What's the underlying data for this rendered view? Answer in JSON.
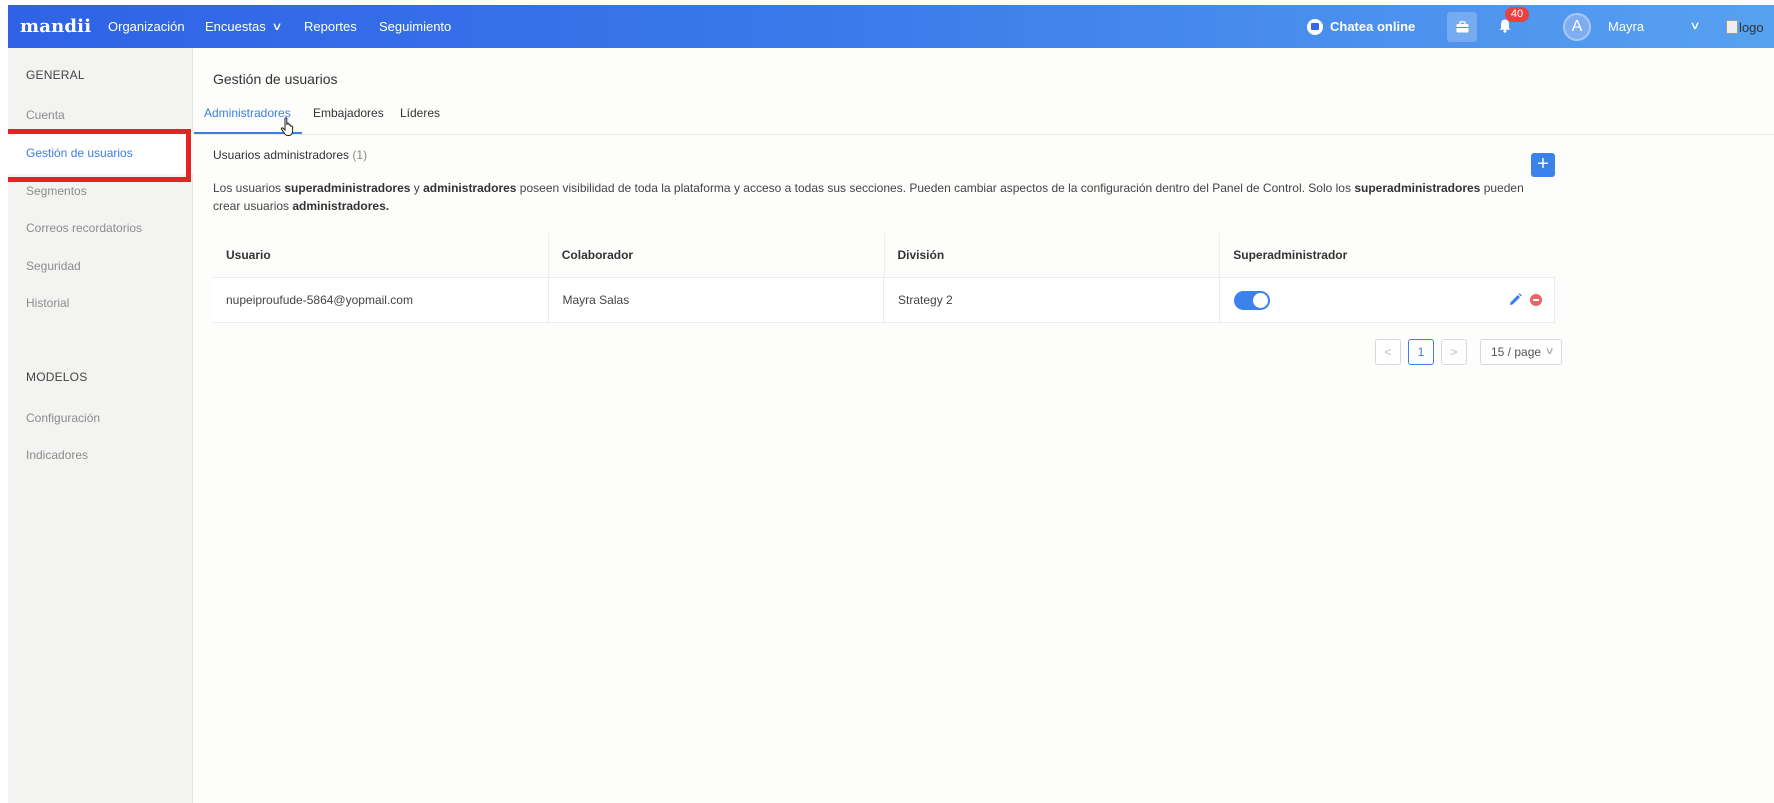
{
  "header": {
    "logo": "mandii",
    "nav": [
      "Organización",
      "Encuestas",
      "Reportes",
      "Seguimiento"
    ],
    "chat_label": "Chatea online",
    "notification_count": "40",
    "avatar_initial": "A",
    "user_name": "Mayra",
    "logo_alt": "logo"
  },
  "sidebar": {
    "general_heading": "GENERAL",
    "general_items": [
      "Cuenta",
      "Gestión de usuarios",
      "Segmentos",
      "Correos recordatorios",
      "Seguridad",
      "Historial"
    ],
    "active_item": "Gestión de usuarios",
    "models_heading": "MODELOS",
    "models_items": [
      "Configuración",
      "Indicadores"
    ]
  },
  "main": {
    "title": "Gestión de usuarios",
    "tabs": [
      "Administradores",
      "Embajadores",
      "Líderes"
    ],
    "active_tab": "Administradores",
    "section_title": "Usuarios administradores",
    "section_count": "(1)",
    "description": {
      "p1": "Los usuarios ",
      "b1": "superadministradores",
      "p2": " y ",
      "b2": "administradores",
      "p3": " poseen visibilidad de toda la plataforma y acceso a todas sus secciones. Pueden cambiar aspectos de la configuración dentro del Panel de Control. Solo los ",
      "b3": "superadministradores",
      "p4": " pueden crear usuarios ",
      "b4": "administradores."
    },
    "table": {
      "columns": [
        "Usuario",
        "Colaborador",
        "División",
        "Superadministrador"
      ],
      "rows": [
        {
          "usuario": "nupeiproufude-5864@yopmail.com",
          "colaborador": "Mayra Salas",
          "division": "Strategy 2",
          "superadmin": true
        }
      ]
    },
    "pagination": {
      "current_page": "1",
      "page_size": "15 / page"
    }
  },
  "colors": {
    "accent": "#3b7ee8",
    "highlight": "#e62229",
    "topbar_start": "#2f62e6",
    "topbar_end": "#57a1f0"
  }
}
